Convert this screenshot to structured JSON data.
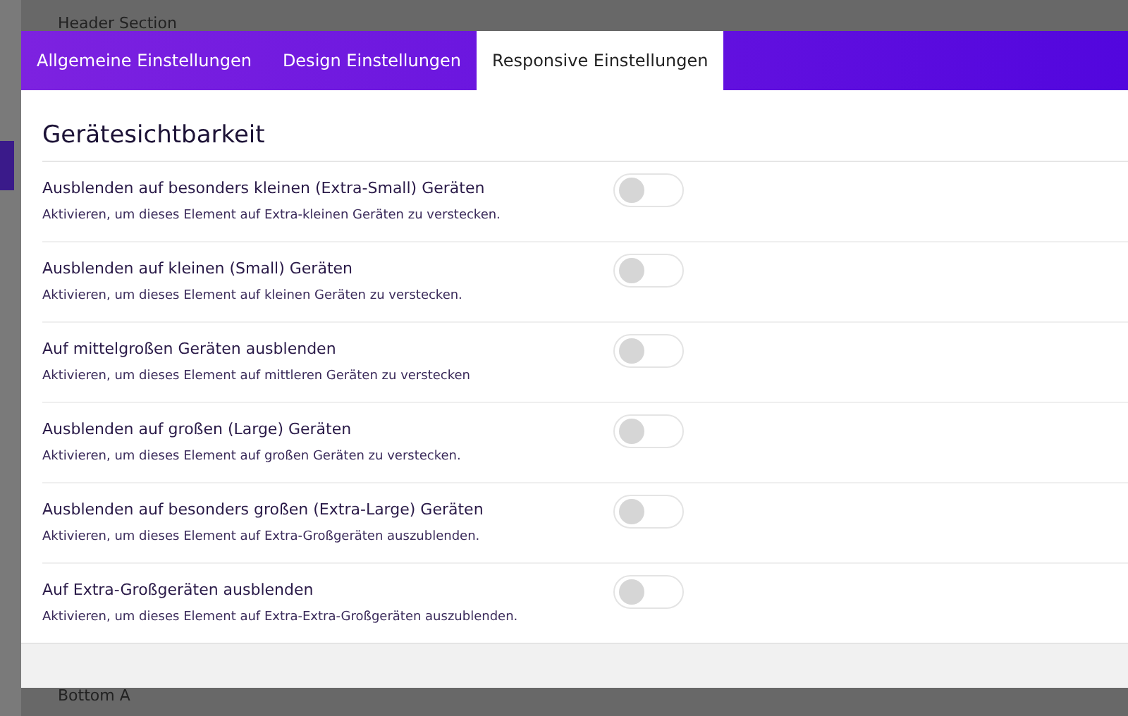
{
  "background": {
    "header": "Header Section",
    "footer": "Bottom A"
  },
  "tabs": [
    {
      "label": "Allgemeine Einstellungen",
      "selected": false
    },
    {
      "label": "Design Einstellungen",
      "selected": false
    },
    {
      "label": "Responsive Einstellungen",
      "selected": true
    }
  ],
  "section": {
    "title": "Gerätesichtbarkeit"
  },
  "settings": [
    {
      "label": "Ausblenden auf besonders kleinen (Extra-Small) Geräten",
      "description": "Aktivieren, um dieses Element auf Extra-kleinen Geräten zu verstecken.",
      "on": false
    },
    {
      "label": "Ausblenden auf kleinen (Small) Geräten",
      "description": "Aktivieren, um dieses Element auf kleinen Geräten zu verstecken.",
      "on": false
    },
    {
      "label": "Auf mittelgroßen Geräten ausblenden",
      "description": "Aktivieren, um dieses Element auf mittleren Geräten zu verstecken",
      "on": false
    },
    {
      "label": "Ausblenden auf großen (Large) Geräten",
      "description": "Aktivieren, um dieses Element auf großen Geräten zu verstecken.",
      "on": false
    },
    {
      "label": "Ausblenden auf besonders großen (Extra-Large) Geräten",
      "description": "Aktivieren, um dieses Element auf Extra-Großgeräten auszublenden.",
      "on": false
    },
    {
      "label": "Auf Extra-Großgeräten ausblenden",
      "description": "Aktivieren, um dieses Element auf Extra-Extra-Großgeräten auszublenden.",
      "on": false
    }
  ]
}
